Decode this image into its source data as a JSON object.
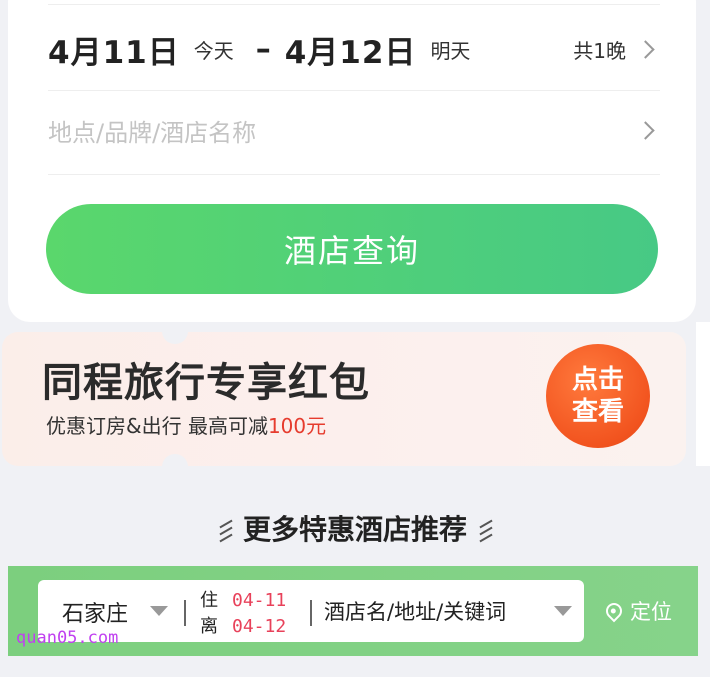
{
  "search": {
    "checkin_date": "4月11日",
    "checkin_label": "今天",
    "separator": "–",
    "checkout_date": "4月12日",
    "checkout_label": "明天",
    "nights": "共1晚",
    "location_placeholder": "地点/品牌/酒店名称",
    "query_button": "酒店查询"
  },
  "banner": {
    "title": "同程旅行专享红包",
    "subtitle_prefix": "优惠订房&出行 最高可减",
    "subtitle_amount": "100元",
    "cta_line1": "点击",
    "cta_line2": "查看",
    "accent_color": "#f2541f"
  },
  "recommend": {
    "title": "更多特惠酒店推荐"
  },
  "filter": {
    "city": "石家庄",
    "stay_label_top": "住",
    "stay_label_bottom": "离",
    "checkin": "04-11",
    "checkout": "04-12",
    "keyword_placeholder": "酒店名/地址/关键词",
    "locate": "定位",
    "bar_color": "#7ccf7e"
  },
  "watermark": "quan05.com",
  "icons": [
    "chevron-right-icon",
    "dropdown-icon",
    "location-pin-icon"
  ]
}
